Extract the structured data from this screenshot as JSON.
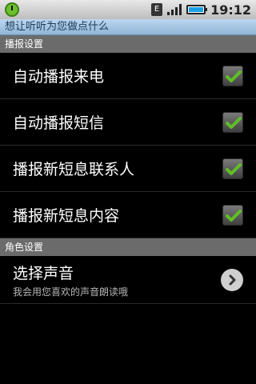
{
  "status_bar": {
    "network_badge": "E",
    "time": "19:12",
    "battery_level": 0.9
  },
  "app_title": "想让听听为您做点什么",
  "sections": [
    {
      "title": "播报设置",
      "items": [
        {
          "label": "自动播报来电",
          "checked": true
        },
        {
          "label": "自动播报短信",
          "checked": true
        },
        {
          "label": "播报新短息联系人",
          "checked": true
        },
        {
          "label": "播报新短息内容",
          "checked": true
        }
      ]
    },
    {
      "title": "角色设置",
      "voice": {
        "title": "选择声音",
        "subtitle": "我会用您喜欢的声音朗读哦"
      }
    }
  ],
  "colors": {
    "check_green": "#5fbf25",
    "section_header": "#6b6b6b"
  },
  "icons": [
    "alarm-icon",
    "network-e-icon",
    "signal-icon",
    "battery-icon",
    "check-icon",
    "chevron-right-icon"
  ]
}
